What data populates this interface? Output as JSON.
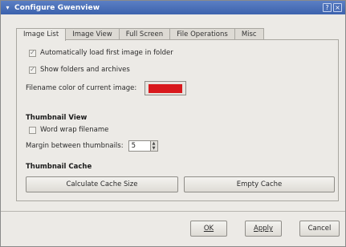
{
  "window": {
    "title": "Configure Gwenview",
    "minimize_glyph": "?",
    "close_glyph": "×"
  },
  "tabs": [
    {
      "label": "Image List",
      "active": true
    },
    {
      "label": "Image View",
      "active": false
    },
    {
      "label": "Full Screen",
      "active": false
    },
    {
      "label": "File Operations",
      "active": false
    },
    {
      "label": "Misc",
      "active": false
    }
  ],
  "image_list": {
    "auto_load_label": "Automatically load first image in folder",
    "auto_load_checked": true,
    "show_folders_label": "Show folders and archives",
    "show_folders_checked": true,
    "filename_color_label": "Filename color of current image:",
    "filename_color": "#d8181c",
    "thumbnail_view_title": "Thumbnail View",
    "word_wrap_label": "Word wrap filename",
    "word_wrap_checked": false,
    "margin_label": "Margin between thumbnails:",
    "margin_value": "5",
    "thumbnail_cache_title": "Thumbnail Cache",
    "calc_cache_label": "Calculate Cache Size",
    "empty_cache_label": "Empty Cache"
  },
  "dialog_buttons": {
    "ok_label": "OK",
    "apply_label": "Apply",
    "cancel_label": "Cancel"
  },
  "icons": {
    "check": "✓",
    "app": "▾",
    "spin_up": "▲",
    "spin_down": "▼"
  }
}
